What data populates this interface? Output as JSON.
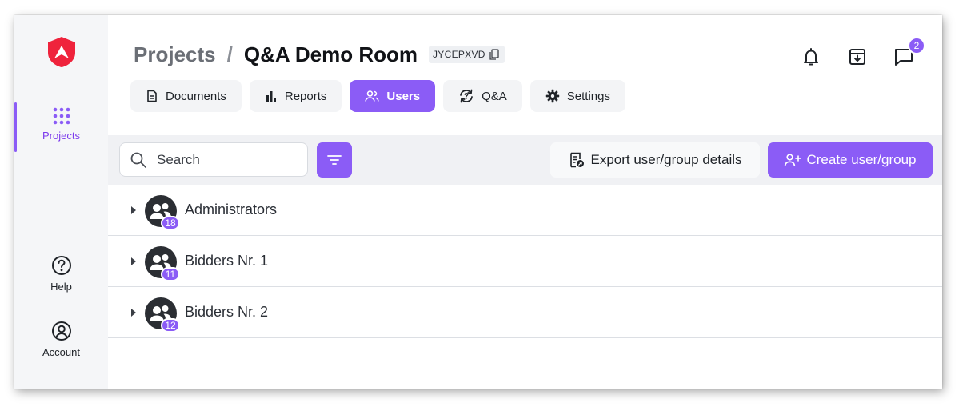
{
  "brand": {
    "accent": "#8b5cf6",
    "logo_color": "#ef233c"
  },
  "leftnav": {
    "projects_label": "Projects",
    "help_label": "Help",
    "account_label": "Account"
  },
  "header": {
    "breadcrumb_root": "Projects",
    "breadcrumb_sep": "/",
    "breadcrumb_current": "Q&A Demo Room",
    "room_code": "JYCEPXVD",
    "messages_badge": "2"
  },
  "tabs": [
    {
      "label": "Documents",
      "icon": "document-icon",
      "active": false
    },
    {
      "label": "Reports",
      "icon": "bar-chart-icon",
      "active": false
    },
    {
      "label": "Users",
      "icon": "users-icon",
      "active": true
    },
    {
      "label": "Q&A",
      "icon": "qa-refresh-icon",
      "active": false
    },
    {
      "label": "Settings",
      "icon": "gear-icon",
      "active": false
    }
  ],
  "toolbar": {
    "search_placeholder": "Search",
    "export_label": "Export user/group details",
    "create_label": "Create user/group"
  },
  "groups": [
    {
      "name": "Administrators",
      "count": "18"
    },
    {
      "name": "Bidders Nr. 1",
      "count": "11"
    },
    {
      "name": "Bidders Nr. 2",
      "count": "12"
    }
  ]
}
